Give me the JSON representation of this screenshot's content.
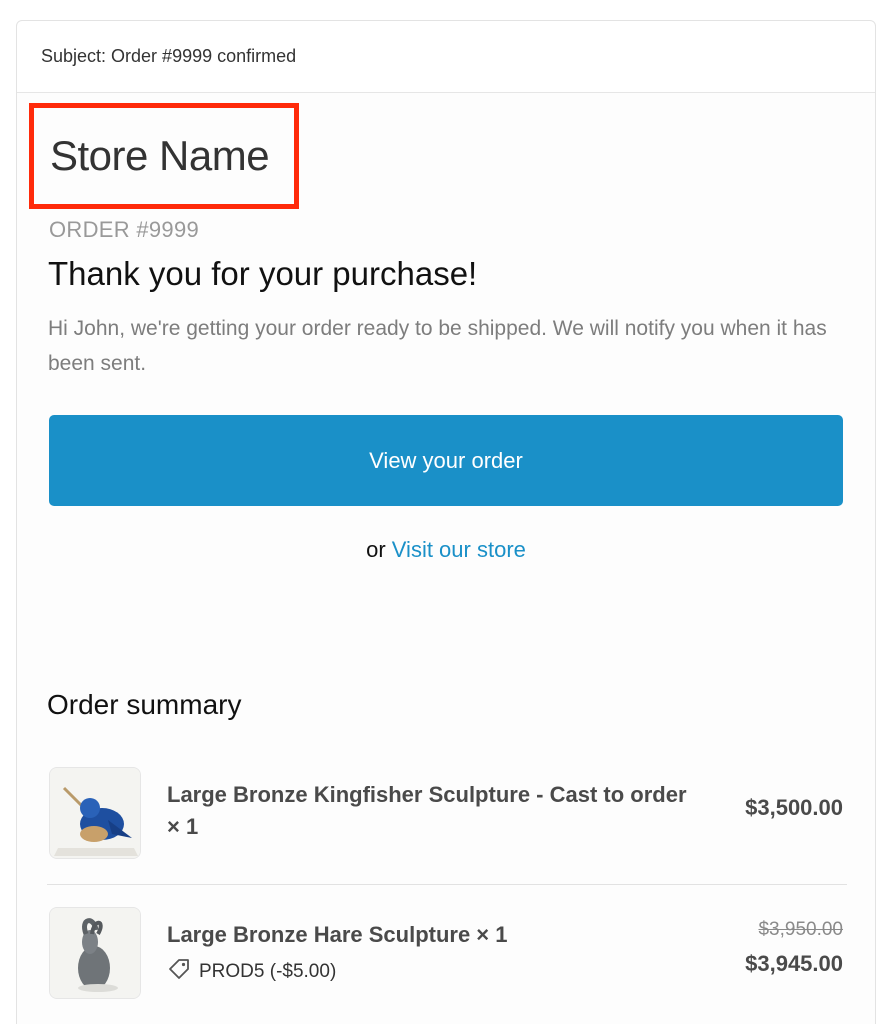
{
  "email": {
    "subject": "Subject: Order #9999 confirmed",
    "store_name": "Store Name",
    "order_number": "ORDER #9999",
    "heading": "Thank you for your purchase!",
    "message": "Hi John, we're getting your order ready to be shipped. We will notify you when it has been sent.",
    "view_order_label": "View your order",
    "or_text": "or ",
    "visit_store_label": "Visit our store",
    "summary_title": "Order summary",
    "highlight_color": "#ff2a0a",
    "accent_color": "#1a90c8"
  },
  "items": [
    {
      "name": "Large Bronze Kingfisher Sculpture - Cast to order × 1",
      "price": "$3,500.00",
      "thumbnail_icon": "kingfisher-sculpture-image"
    },
    {
      "name": "Large Bronze Hare Sculpture × 1",
      "discount": "PROD5 (-$5.00)",
      "discount_icon": "tag-icon",
      "original_price": "$3,950.00",
      "price": "$3,945.00",
      "thumbnail_icon": "hare-sculpture-image"
    }
  ]
}
